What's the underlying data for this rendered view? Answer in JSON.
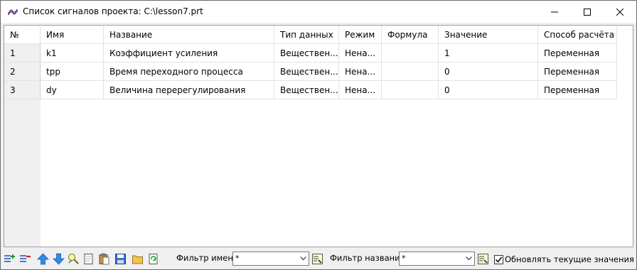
{
  "window": {
    "title": "Список сигналов проекта: C:\\lesson7.prt"
  },
  "table": {
    "headers": [
      "№",
      "Имя",
      "Название",
      "Тип данных",
      "Режим",
      "Формула",
      "Значение",
      "Способ расчёта"
    ],
    "rows": [
      [
        "1",
        "k1",
        "Коэффициент усиления",
        "Веществен...",
        "Нена...",
        "",
        "1",
        "Переменная"
      ],
      [
        "2",
        "tpp",
        "Время переходного процесса",
        "Веществен...",
        "Нена...",
        "",
        "0",
        "Переменная"
      ],
      [
        "3",
        "dy",
        "Величина перерегулирования",
        "Веществен...",
        "Нена...",
        "",
        "0",
        "Переменная"
      ]
    ]
  },
  "toolbar": {
    "name_filter_label": "Фильтр имени",
    "name_filter_value": "*",
    "title_filter_label": "Фильтр названия",
    "title_filter_value": "*",
    "refresh_label": "Обновлять текущие значения",
    "refresh_checked": true
  },
  "colors": {
    "accent_blue": "#1e73d2",
    "header_gray": "#f0f0f0"
  }
}
